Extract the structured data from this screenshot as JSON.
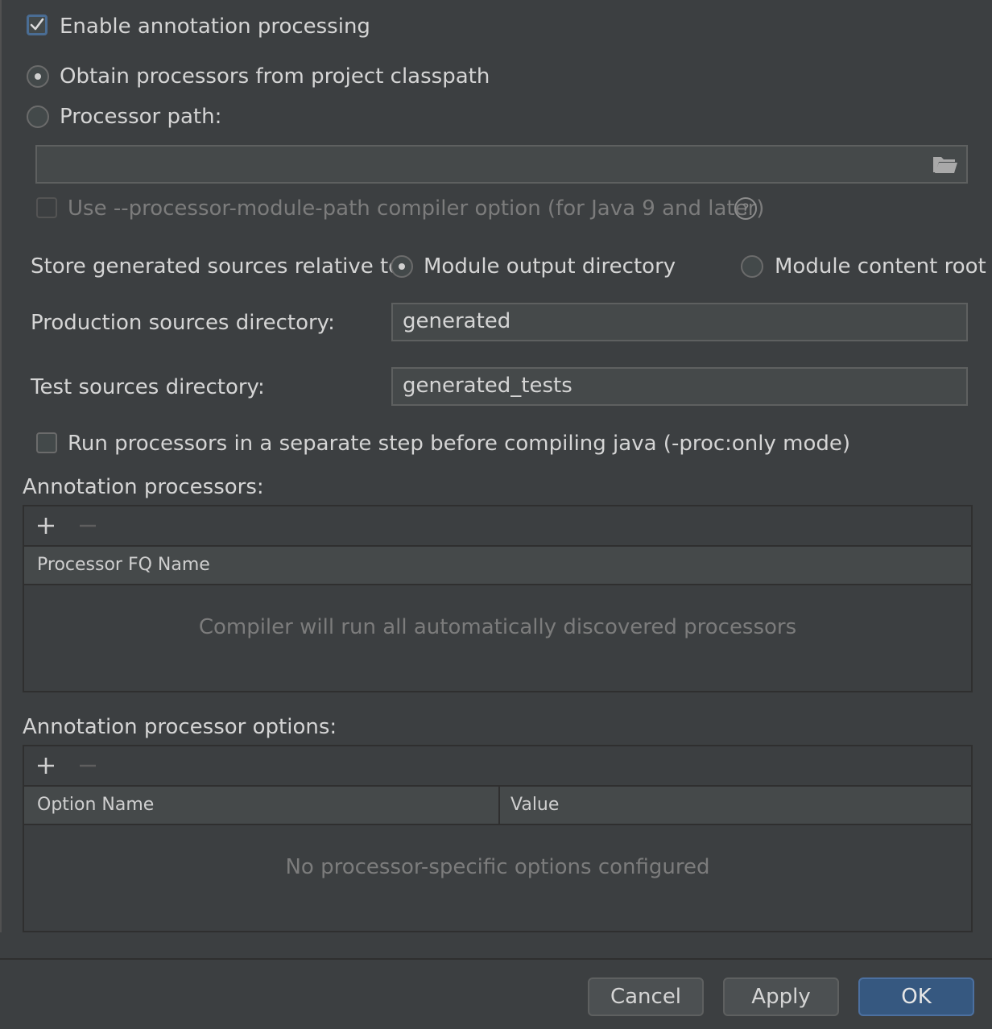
{
  "enable_processing": {
    "label": "Enable annotation processing",
    "checked": true
  },
  "obtain_radio": {
    "label": "Obtain processors from project classpath",
    "selected": true
  },
  "processor_path_radio": {
    "label": "Processor path:",
    "selected": false
  },
  "processor_path_field": {
    "value": ""
  },
  "module_path_option": {
    "label": "Use --processor-module-path compiler option (for Java 9 and later)",
    "checked": false,
    "enabled": false
  },
  "store_relative": {
    "label": "Store generated sources relative to:",
    "option_output": "Module output directory",
    "option_content": "Module content root",
    "selected": "Module output directory"
  },
  "production_dir": {
    "label": "Production sources directory:",
    "value": "generated"
  },
  "test_dir": {
    "label": "Test sources directory:",
    "value": "generated_tests"
  },
  "separate_step": {
    "label": "Run processors in a separate step before compiling java (-proc:only mode)",
    "checked": false
  },
  "processors_section": {
    "title": "Annotation processors:",
    "columns": [
      "Processor FQ Name"
    ],
    "empty_text": "Compiler will run all automatically discovered processors"
  },
  "options_section": {
    "title": "Annotation processor options:",
    "columns": [
      "Option Name",
      "Value"
    ],
    "empty_text": "No processor-specific options configured"
  },
  "buttons": {
    "cancel": "Cancel",
    "apply": "Apply",
    "ok": "OK"
  },
  "colors": {
    "background": "#3c3f41",
    "accent": "#365880",
    "text": "#d5d5d5",
    "muted": "#7c7c7c"
  }
}
